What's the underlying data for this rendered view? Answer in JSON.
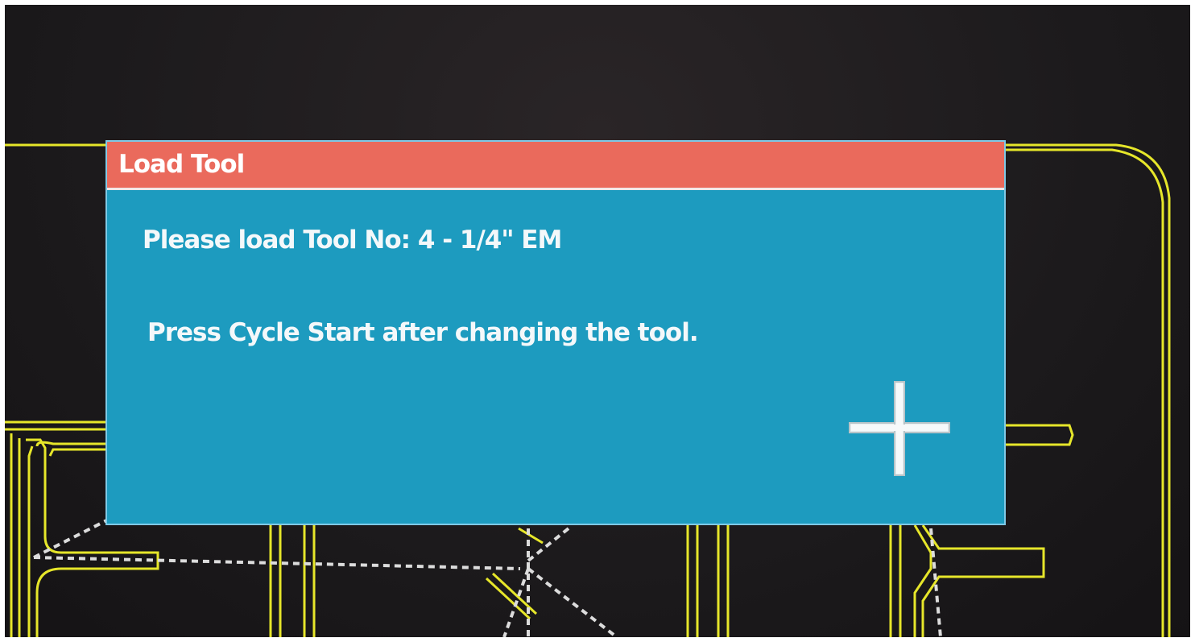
{
  "dialog": {
    "title": "Load Tool",
    "line1": "Please load Tool No: 4 - 1/4\" EM",
    "line2": "Press Cycle Start after changing the tool."
  },
  "icons": {
    "cursor": "crosshair-cursor-icon"
  },
  "colors": {
    "title_bar": "#ea6a5c",
    "dialog_body": "#1d9bbf",
    "cad_lines": "#e6e62a",
    "toolpath": "#dcdcdc",
    "background": "#1c1a1c"
  }
}
